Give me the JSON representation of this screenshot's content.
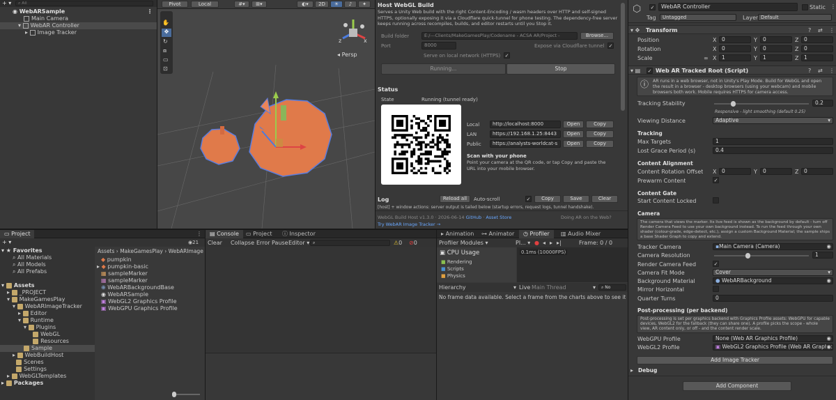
{
  "hierarchy": {
    "search_placeholder": "All",
    "scene": "WebARSample",
    "items": [
      "Main Camera",
      "WebAR Controller",
      "Image Tracker"
    ]
  },
  "scene_toolbar": {
    "pivot": "Pivot",
    "local": "Local",
    "mode_2d": "2D",
    "persp": "Persp",
    "gizmo_x": "x",
    "gizmo_z": "z"
  },
  "host": {
    "title": "Host WebGL Build",
    "description": "Serves a Unity Web build with the right Content-Encoding / wasm headers over HTTP and self-signed HTTPS, optionally exposing it via a Cloudflare quick-tunnel for phone testing. The dependency-free server keeps running across recompiles, builds, and editor restarts until you Stop it.",
    "build_folder_label": "Build folder",
    "build_folder_value": "E:/---Clients/MakeGamesPlay/Codename - ACSA AR/Project -",
    "browse": "Browse...",
    "port_label": "Port",
    "port_value": "8000",
    "expose_label": "Expose via Cloudflare tunnel",
    "serve_local": "Serve on local network (HTTPS)",
    "running_btn": "Running...",
    "stop_btn": "Stop",
    "status_title": "Status",
    "state_label": "State",
    "state_value": "Running (tunnel ready)",
    "urls": [
      {
        "label": "Local",
        "value": "http://localhost:8000"
      },
      {
        "label": "LAN",
        "value": "https://192.168.1.25:8443"
      },
      {
        "label": "Public",
        "value": "https://analysts-worldcat-s"
      }
    ],
    "open": "Open",
    "copy": "Copy",
    "scan_title": "Scan with your phone",
    "scan_text": "Point your camera at the QR code, or tap Copy and paste the URL into your mobile browser.",
    "log_title": "Log",
    "reload_all": "Reload all",
    "auto_scroll": "Auto-scroll",
    "log_copy": "Copy",
    "log_save": "Save",
    "log_clear": "Clear",
    "log_line": "[host] + window actions: server output is tailed below (startup errors, request logs, tunnel handshake).",
    "footer_version": "WebGL Build Host v1.3.0 · 2026-06-14",
    "footer_github": "GitHub",
    "footer_store": "Asset Store",
    "footer_try": "Try WebAR Image Tracker →",
    "footer_doing": "Doing AR on the Web?"
  },
  "project": {
    "tab": "Project",
    "count": "21",
    "favorites": "Favorites",
    "fav_items": [
      "All Materials",
      "All Models",
      "All Prefabs"
    ],
    "assets": "Assets",
    "tree": [
      "_PROJECT",
      "MakeGamesPlay",
      "WebARImageTracker",
      "Editor",
      "Runtime",
      "Plugins",
      "WebGL",
      "Resources",
      "Sample",
      "WebBuildHost",
      "Scenes",
      "Settings",
      "WebGLTemplates"
    ],
    "packages": "Packages",
    "breadcrumb": [
      "Assets",
      "MakeGamesPlay",
      "WebARImage"
    ],
    "files": [
      "pumpkin",
      "pumpkin-basic",
      "sampleMarker",
      "sampleMarker",
      "WebARBackgroundBase",
      "WebARSample",
      "WebGL2 Graphics Profile",
      "WebGPU Graphics Profile"
    ]
  },
  "console": {
    "tabs": [
      "Console",
      "Project",
      "Inspector"
    ],
    "clear": "Clear",
    "collapse": "Collapse",
    "error_pause": "Error Pause",
    "editor": "Editor",
    "counts": [
      "0",
      "0"
    ]
  },
  "profiler": {
    "tabs": [
      "Animation",
      "Animator",
      "Profiler",
      "Audio Mixer"
    ],
    "modules": "Profiler Modules",
    "play": "Pl...",
    "frame": "Frame: 0 / 0",
    "cpu_title": "CPU Usage",
    "cpu_value": "0.1ms (10000FPS)",
    "legend": [
      "Rendering",
      "Scripts",
      "Physics"
    ],
    "hierarchy": "Hierarchy",
    "live": "Live",
    "main_thread": "Main Thread",
    "no_frame": "No frame data available. Select a frame from the charts above to see its detai"
  },
  "inspector": {
    "name": "WebAR Controller",
    "static": "Static",
    "tag_label": "Tag",
    "tag_value": "Untagged",
    "layer_label": "Layer",
    "layer_value": "Default",
    "transform_title": "Transform",
    "position_label": "Position",
    "rotation_label": "Rotation",
    "scale_label": "Scale",
    "position": [
      "0",
      "0",
      "0"
    ],
    "rotation": [
      "0",
      "0",
      "0"
    ],
    "scale": [
      "1",
      "1",
      "1"
    ],
    "component_title": "Web AR Tracked Root (Script)",
    "component_help": "AR runs in a web browser, not in Unity's Play Mode. Build for WebGL and open the result in a browser - desktop browsers (using your webcam) and mobile browsers both work. Mobile requires HTTPS for camera access.",
    "tracking_stability_label": "Tracking Stability",
    "tracking_stability_value": "0.2",
    "tracking_stability_level": 0.2,
    "tracking_stability_note": "Responsive - light smoothing (default 0.25)",
    "viewing_distance_label": "Viewing Distance",
    "viewing_distance_value": "Adaptive",
    "tracking_header": "Tracking",
    "max_targets_label": "Max Targets",
    "max_targets_value": "1",
    "lost_grace_label": "Lost Grace Period (s)",
    "lost_grace_value": "0.4",
    "content_alignment_header": "Content Alignment",
    "content_rotation_label": "Content Rotation Offset",
    "content_rotation": [
      "0",
      "0",
      "0"
    ],
    "prewarm_label": "Prewarm Content",
    "content_gate_header": "Content Gate",
    "start_locked_label": "Start Content Locked",
    "camera_header": "Camera",
    "camera_help": "The camera that views the marker. Its live feed is shown as the background by default - turn off Render Camera Feed to use your own background instead. To run the feed through your own shader (colour-grade, edge-detect, etc.), assign a custom Background Material; the sample ships a base Shader Graph to copy and extend.",
    "tracker_camera_label": "Tracker Camera",
    "tracker_camera_value": "Main Camera (Camera)",
    "camera_resolution_label": "Camera Resolution",
    "camera_resolution_value": "1",
    "render_feed_label": "Render Camera Feed",
    "fit_mode_label": "Camera Fit Mode",
    "fit_mode_value": "Cover",
    "background_material_label": "Background Material",
    "background_material_value": "WebARBackground",
    "mirror_label": "Mirror Horizontal",
    "quarter_turns_label": "Quarter Turns",
    "quarter_turns_value": "0",
    "postprocessing_header": "Post-processing (per backend)",
    "postprocessing_help": "Post-processing is set per graphics backend with Graphics Profile assets: WebGPU for capable devices, WebGL2 for the fallback (they can share one). A profile picks the scope - whole view, AR content only, or off - and the content render scale.",
    "webgpu_label": "WebGPU Profile",
    "webgpu_value": "None (Web AR Graphics Profile)",
    "webgl2_label": "WebGL2 Profile",
    "webgl2_value": "WebGL2 Graphics Profile (Web AR Graphics",
    "add_image_tracker": "Add Image Tracker",
    "debug": "Debug",
    "add_component": "Add Component"
  }
}
